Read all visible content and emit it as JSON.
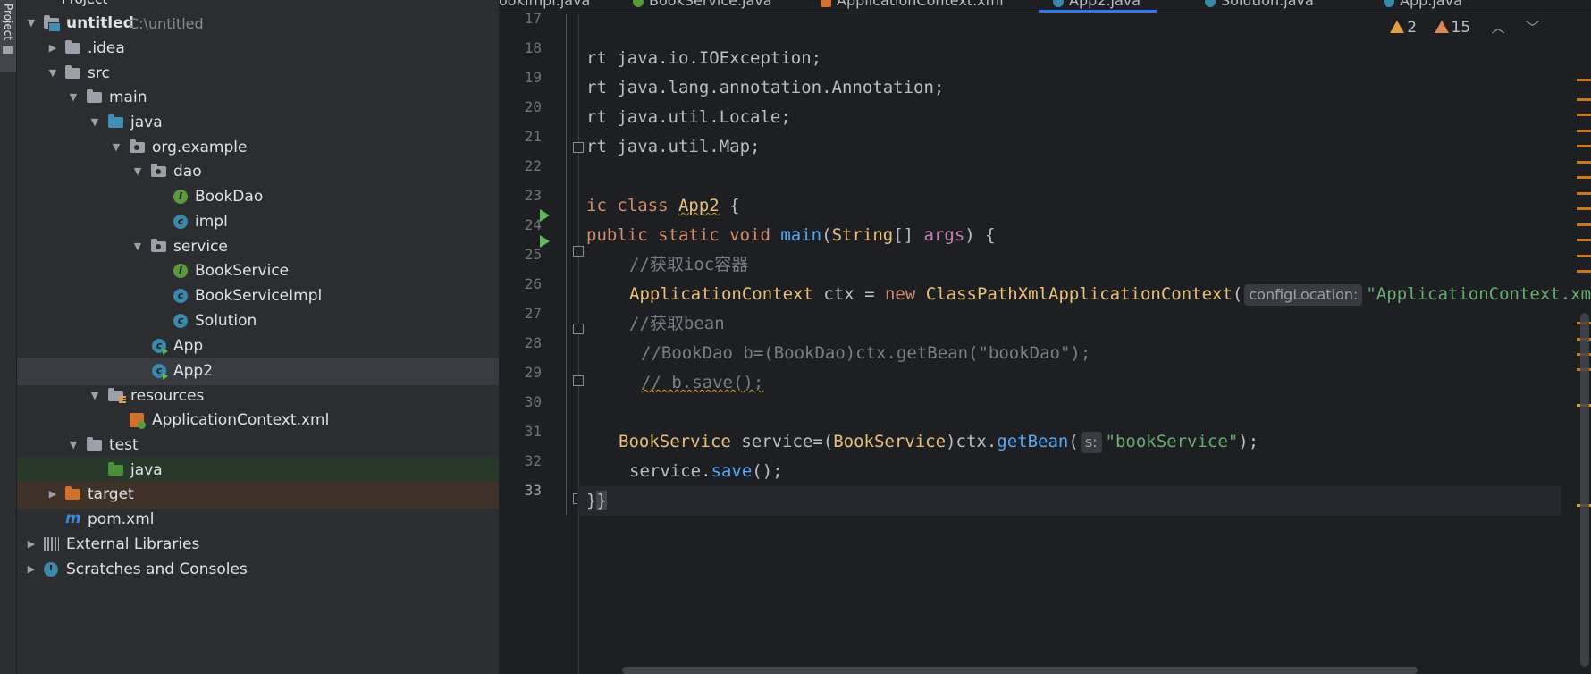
{
  "sidebar": {
    "tab_label": "Project"
  },
  "project_header": {
    "title": "Project"
  },
  "tree": {
    "root": {
      "label": "untitled",
      "path": "C:\\untitled"
    },
    "idea": "idea",
    "idea_full": ".idea",
    "src": "src",
    "main": "main",
    "java": "java",
    "org_example": "org.example",
    "dao": "dao",
    "bookdao": "BookDao",
    "impl": "impl",
    "service": "service",
    "bookservice": "BookService",
    "bookserviceimpl": "BookServiceImpl",
    "solution": "Solution",
    "app": "App",
    "app2": "App2",
    "resources": "resources",
    "appctx": "ApplicationContext.xml",
    "test": "test",
    "test_java": "java",
    "target": "target",
    "pom": "pom.xml",
    "external_libraries": "External Libraries",
    "scratches": "Scratches and Consoles"
  },
  "tabs": [
    {
      "label": "ookImpl.java",
      "icon": "class-icon"
    },
    {
      "label": "BookService.java",
      "icon": "interface-icon"
    },
    {
      "label": "ApplicationContext.xml",
      "icon": "xml-icon"
    },
    {
      "label": "App2.java",
      "icon": "class-icon",
      "active": true
    },
    {
      "label": "Solution.java",
      "icon": "class-icon"
    },
    {
      "label": "App.java",
      "icon": "class-icon"
    }
  ],
  "inspections": {
    "warnings": "2",
    "weak_warnings": "15"
  },
  "editor": {
    "line_numbers": [
      "17",
      "18",
      "19",
      "20",
      "21",
      "22",
      "23",
      "24",
      "25",
      "26",
      "27",
      "28",
      "29",
      "30",
      "31",
      "32",
      "33"
    ],
    "code": {
      "l18": "rt java.io.IOException;",
      "l19": "rt java.lang.annotation.Annotation;",
      "l20": "rt java.util.Locale;",
      "l21": "rt java.util.Map;",
      "l23_kw": "ic class ",
      "l23_name": "App2",
      "l23_brace": " {",
      "l24_kw": "public static void ",
      "l24_fn": "main",
      "l24_p1": "(",
      "l24_type": "String",
      "l24_p2": "[] ",
      "l24_arg": "args",
      "l24_p3": ") {",
      "l25": "//获取ioc容器",
      "l26_type": "ApplicationContext",
      "l26_mid": " ctx = ",
      "l26_new": "new ",
      "l26_cls": "ClassPathXmlApplicationContext",
      "l26_paren": "(",
      "l26_hint": "configLocation:",
      "l26_str": "\"ApplicationContext.xml\");",
      "l27": "//获取bean",
      "l28": "//BookDao b=(BookDao)ctx.getBean(\"bookDao\");",
      "l29": "// b.save();",
      "l31_type": "BookService",
      "l31_a": " service=(",
      "l31_type2": "BookService",
      "l31_b": ")ctx.",
      "l31_fn": "getBean",
      "l31_c": "(",
      "l31_hint": "s:",
      "l31_str": "\"bookService\"",
      "l31_d": ");",
      "l32_a": "service.",
      "l32_fn": "save",
      "l32_b": "();",
      "l33_a": "}",
      "l33_b": "}"
    }
  }
}
